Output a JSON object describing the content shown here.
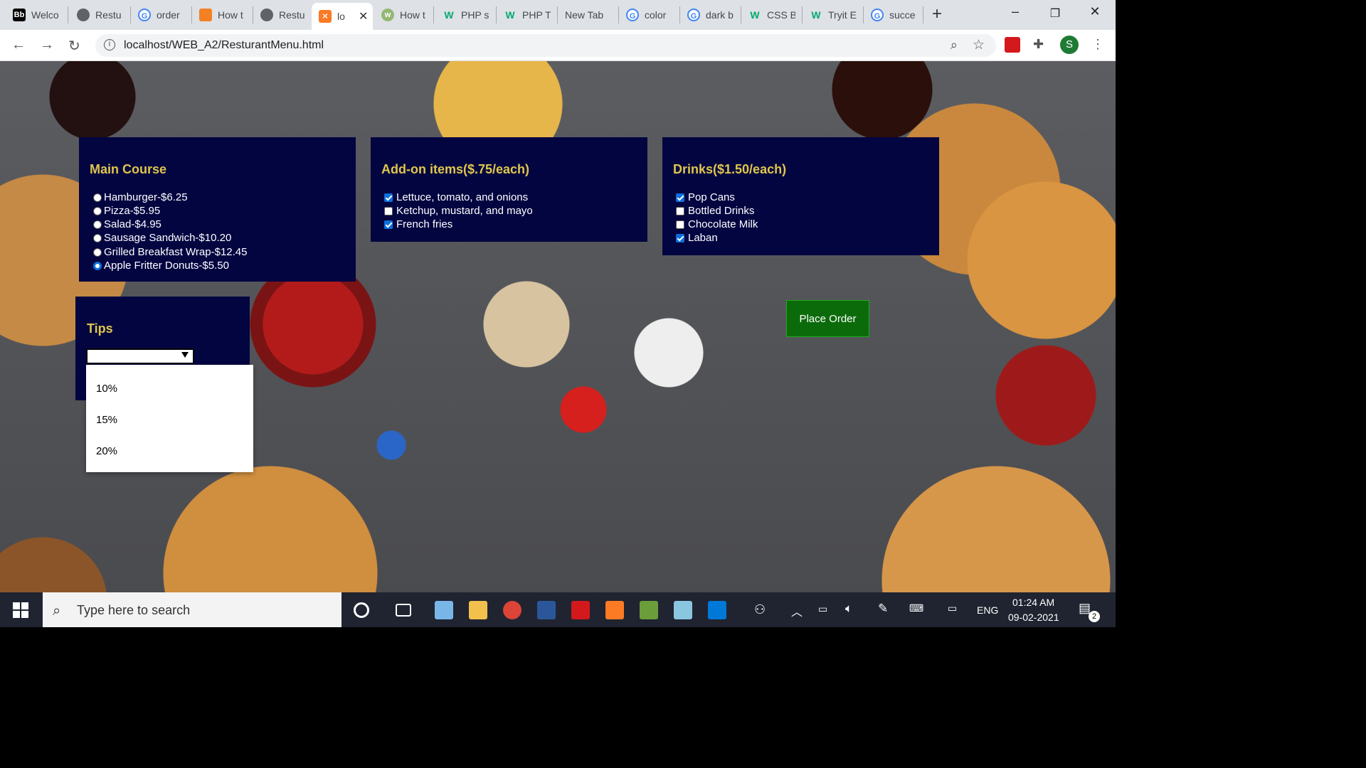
{
  "browser": {
    "tabs": [
      {
        "label": "Welco",
        "icon": "bb-icon",
        "icon_color": "#000000"
      },
      {
        "label": "Restu",
        "icon": "globe-icon",
        "icon_color": "#5f6368"
      },
      {
        "label": "order",
        "icon": "google-icon",
        "icon_color": "#4285f4"
      },
      {
        "label": "How t",
        "icon": "stackoverflow-icon",
        "icon_color": "#f48024"
      },
      {
        "label": "Restu",
        "icon": "globe-icon",
        "icon_color": "#5f6368"
      },
      {
        "label": "lo",
        "icon": "xampp-icon",
        "icon_color": "#fb7a24",
        "active": true
      },
      {
        "label": "How t",
        "icon": "wikihow-icon",
        "icon_color": "#93b874"
      },
      {
        "label": "PHP s",
        "icon": "w3schools-icon",
        "icon_color": "#04aa6d"
      },
      {
        "label": "PHP T",
        "icon": "w3schools-icon",
        "icon_color": "#04aa6d"
      },
      {
        "label": "New Tab",
        "icon": "",
        "icon_color": ""
      },
      {
        "label": "color",
        "icon": "google-icon",
        "icon_color": "#4285f4"
      },
      {
        "label": "dark b",
        "icon": "google-icon",
        "icon_color": "#4285f4"
      },
      {
        "label": "CSS B",
        "icon": "w3schools-icon",
        "icon_color": "#04aa6d"
      },
      {
        "label": "Tryit E",
        "icon": "w3schools-icon",
        "icon_color": "#04aa6d"
      },
      {
        "label": "succe",
        "icon": "google-icon",
        "icon_color": "#4285f4"
      }
    ],
    "url": "localhost/WEB_A2/ResturantMenu.html",
    "profile_initial": "S"
  },
  "menu": {
    "main_title": "Main Course",
    "main_items": [
      {
        "label": "Hamburger-$6.25",
        "selected": false
      },
      {
        "label": "Pizza-$5.95",
        "selected": false
      },
      {
        "label": "Salad-$4.95",
        "selected": false
      },
      {
        "label": "Sausage Sandwich-$10.20",
        "selected": false
      },
      {
        "label": "Grilled Breakfast Wrap-$12.45",
        "selected": false
      },
      {
        "label": "Apple Fritter Donuts-$5.50",
        "selected": true
      }
    ],
    "addon_title": "Add-on items($.75/each)",
    "addon_items": [
      {
        "label": "Lettuce, tomato, and onions",
        "checked": true
      },
      {
        "label": "Ketchup, mustard, and mayo",
        "checked": false
      },
      {
        "label": "French fries",
        "checked": true
      }
    ],
    "drinks_title": "Drinks($1.50/each)",
    "drinks_items": [
      {
        "label": "Pop Cans",
        "checked": true
      },
      {
        "label": "Bottled Drinks",
        "checked": false
      },
      {
        "label": "Chocolate Milk",
        "checked": false
      },
      {
        "label": "Laban",
        "checked": true
      }
    ],
    "tips_title": "Tips",
    "tips_selected": "",
    "tips_options": [
      "10%",
      "15%",
      "20%"
    ],
    "place_order": "Place Order"
  },
  "taskbar": {
    "search_placeholder": "Type here to search",
    "language": "ENG",
    "time": "01:24 AM",
    "date": "09-02-2021",
    "notifications": "2"
  },
  "colors": {
    "panel": "#030541",
    "title": "#e0c64c",
    "order_button": "#0b6b0b"
  }
}
